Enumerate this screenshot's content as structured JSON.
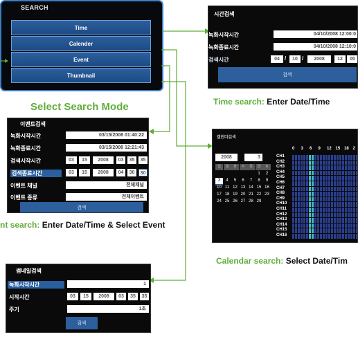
{
  "menu": {
    "title": "SEARCH",
    "items": [
      "Time",
      "Calender",
      "Event",
      "Thumbnail"
    ]
  },
  "select_caption": "Select Search Mode",
  "time_panel": {
    "title": "시간검색",
    "rows": [
      {
        "label": "녹화시작시간",
        "value": "04/10/2008 12:00:0"
      },
      {
        "label": "녹화종료시간",
        "value": "04/10/2008 12:10:0"
      }
    ],
    "search_time_label": "검색시간",
    "date_fields": [
      "04",
      "10",
      "2008",
      "12",
      "00"
    ],
    "separators": [
      "/",
      "/"
    ],
    "button": "검색"
  },
  "time_caption": {
    "highlight": "Time search:",
    "rest": " Enter Date/Time"
  },
  "event_panel": {
    "title": "이벤트검색",
    "rows": [
      {
        "label": "녹화시작시간",
        "value": "03/15/2008 01:40:22"
      },
      {
        "label": "녹화종료시간",
        "value": "03/15/2008 12:21:43"
      }
    ],
    "start_label": "검색시작시간",
    "start_fields": [
      "03",
      "15",
      "2008",
      "03",
      "35",
      "35"
    ],
    "end_label": "검색종료시간",
    "end_fields": [
      "03",
      "15",
      "2008",
      "04",
      "30",
      "30"
    ],
    "channel_label": "이벤트 채널",
    "channel_value": "전체채널",
    "type_label": "이벤트 종류",
    "type_value": "전체이벤트",
    "button": "검색"
  },
  "event_caption": {
    "highlight": "nt search:",
    "rest": " Enter Date/Time & Select Event"
  },
  "calendar_panel": {
    "title": "캘린더검색",
    "year": "2008",
    "month": "3",
    "weekdays": [
      "일",
      "월",
      "화",
      "수",
      "목",
      "금",
      "토"
    ],
    "days_rows": [
      [
        "",
        "",
        "",
        "",
        "",
        "1",
        "2"
      ],
      [
        "3",
        "4",
        "5",
        "6",
        "7",
        "8",
        "9"
      ],
      [
        "10",
        "11",
        "12",
        "13",
        "14",
        "15",
        "16"
      ],
      [
        "17",
        "18",
        "19",
        "20",
        "21",
        "22",
        "23"
      ],
      [
        "24",
        "25",
        "26",
        "27",
        "28",
        "29",
        ""
      ]
    ],
    "hours": [
      "0",
      "3",
      "6",
      "9",
      "12",
      "15",
      "18",
      "2"
    ],
    "channels": [
      "CH1",
      "CH2",
      "CH3",
      "CH4",
      "CH5",
      "CH6",
      "CH7",
      "CH8",
      "CH9",
      "CH10",
      "CH11",
      "CH12",
      "CH13",
      "CH14",
      "CH15",
      "CH16"
    ]
  },
  "calendar_caption": {
    "highlight": "Calendar search:",
    "rest": " Select Date/Tim"
  },
  "thumb_panel": {
    "title": "썸네일검색",
    "channel_label": "녹화시작시간",
    "channel_value": "1",
    "start_label": "시작시간",
    "start_fields": [
      "03",
      "15",
      "2008",
      "03",
      "35",
      "35"
    ],
    "period_label": "주기",
    "period_value": "1초",
    "button": "검색"
  },
  "colors": {
    "accent": "#5fae3a",
    "panel": "#0a0a0a",
    "button": "#2c5f9c",
    "grid_cyan": "#46b8c8"
  }
}
